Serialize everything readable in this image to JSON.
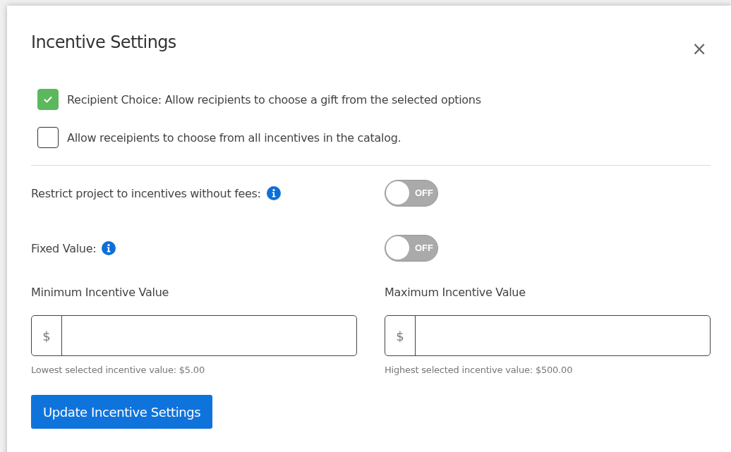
{
  "dialog": {
    "title": "Incentive Settings",
    "close": "×"
  },
  "checkboxes": [
    {
      "label": "Recipient Choice: Allow recipients to choose a gift from the selected options",
      "checked": true
    },
    {
      "label": "Allow receipients to choose from all incentives in the catalog.",
      "checked": false
    }
  ],
  "toggles": [
    {
      "label": "Restrict project to incentives without fees:",
      "on": false,
      "text": "OFF"
    },
    {
      "label": "Fixed Value:",
      "on": false,
      "text": "OFF"
    }
  ],
  "fields": [
    {
      "label": "Minimum Incentive Value",
      "prefix": "$",
      "help": "Lowest selected incentive value: $5.00"
    },
    {
      "label": "Maximum Incentive Value",
      "prefix": "$",
      "help": "Highest selected incentive value: $500.00"
    }
  ],
  "button": "Update Incentive Settings"
}
